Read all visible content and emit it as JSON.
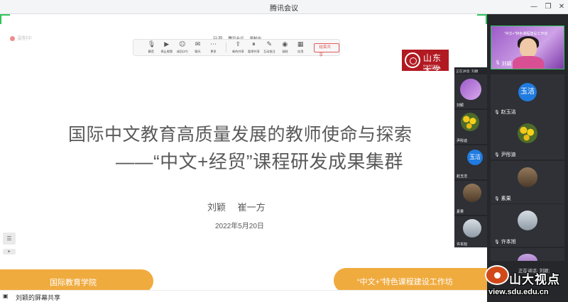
{
  "window": {
    "title": "腾讯会议"
  },
  "recording": {
    "label": "录制中"
  },
  "meeting_status": {
    "time": "11:35",
    "app": "腾讯会议",
    "recording": "录制中"
  },
  "toolbar": {
    "items": [
      {
        "label": "静音",
        "icon": "mic-icon"
      },
      {
        "label": "停止视频",
        "icon": "camera-icon"
      },
      {
        "label": "成员(27)",
        "icon": "members-icon"
      },
      {
        "label": "聊天",
        "icon": "chat-icon"
      },
      {
        "label": "更多",
        "icon": "more-icon"
      },
      {
        "label": "新的共享",
        "icon": "share-icon"
      },
      {
        "label": "暂停共享",
        "icon": "pause-share-icon"
      },
      {
        "label": "互动批注",
        "icon": "annotate-icon"
      },
      {
        "label": "录制",
        "icon": "record-icon"
      },
      {
        "label": "应用",
        "icon": "apps-icon"
      }
    ],
    "end_label": "结束共享"
  },
  "slide": {
    "logo_cn": "山东大学",
    "logo_en": "SHANDONG UNIVERSITY",
    "title_line1": "国际中文教育高质量发展的教师使命与探索",
    "title_line2": "——“中文+经贸”课程研发成果集群",
    "authors": "刘颖　 崔一方",
    "date": "2022年5月20日",
    "left_banner": "国际教育学院",
    "right_banner": "“中文+”特色课程建设工作坊"
  },
  "footer": {
    "text": "刘颖的屏幕共享"
  },
  "float_panel": {
    "header": "正在讲话: 刘颖",
    "participants": [
      {
        "name": "刘颖"
      },
      {
        "name": "赵玉洁",
        "avatar_text": "玉洁"
      },
      {
        "name": "尹彤迪"
      },
      {
        "name": "赵玉洁",
        "avatar_text": "玉洁"
      },
      {
        "name": "素果"
      },
      {
        "name": "许本旭"
      }
    ]
  },
  "sidebar": {
    "host": {
      "name": "刘颖",
      "banner": "“中文+”特色课程建设工作坊"
    },
    "participants": [
      {
        "name": "赵玉洁",
        "avatar_text": "玉洁"
      },
      {
        "name": "尹彤迪"
      },
      {
        "name": "素果"
      },
      {
        "name": "许本旭"
      }
    ],
    "speaking": "正在讲话: 刘颖;"
  },
  "watermark": {
    "title": "山大视点",
    "url": "view.sdu.edu.cn"
  }
}
